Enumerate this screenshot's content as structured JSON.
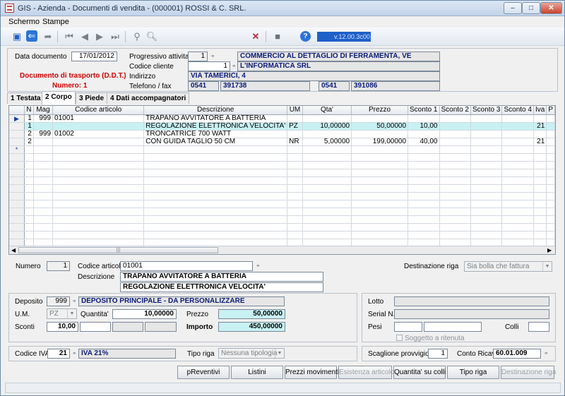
{
  "window": {
    "title": "GIS - Azienda - Documenti di vendita - (000001) ROSSI & C. SRL.",
    "min": "‒",
    "max": "□",
    "close": "✕"
  },
  "menu": [
    "Schermo",
    "Stampe"
  ],
  "toolbar": {
    "version": "v.12.00.3c00"
  },
  "header": {
    "data_documento_label": "Data documento",
    "data_documento": "17/01/2012",
    "progressivo_label": "Progressivo attivita'",
    "progressivo": "1",
    "attivita": "COMMERCIO AL DETTAGLIO DI FERRAMENTA, VE",
    "codice_cliente_label": "Codice cliente",
    "codice_cliente": "1",
    "cliente": "L'INFORMATICA SRL",
    "indirizzo_label": "Indirizzo",
    "indirizzo": "VIA TAMERICI, 4",
    "telefono_label": "Telefono / fax",
    "tel_prefix": "0541",
    "tel": "391738",
    "fax_prefix": "0541",
    "fax": "391086",
    "doc_type": "Documento di trasporto (D.D.T.)",
    "numero": "Numero: 1"
  },
  "tabs": [
    "1 Testata",
    "2 Corpo",
    "3 Piede",
    "4 Dati accompagnatori"
  ],
  "grid": {
    "columns": [
      "N",
      "Mag",
      "Codice articolo",
      "Descrizione",
      "UM",
      "Qta'",
      "Prezzo",
      "Sconto 1",
      "Sconto 2",
      "Sconto 3",
      "Sconto 4",
      "Iva",
      "P"
    ],
    "rows": [
      {
        "marker": "▶",
        "n": "1",
        "mag": "999",
        "codice": "01001",
        "desc": "TRAPANO AVVITATORE A BATTERIA",
        "um": "",
        "qta": "",
        "prezzo": "",
        "s1": "",
        "iva": ""
      },
      {
        "marker": "",
        "n": "1",
        "mag": "",
        "codice": "",
        "desc": "REGOLAZIONE ELETTRONICA VELOCITA'",
        "um": "PZ",
        "qta": "10,00000",
        "prezzo": "50,00000",
        "s1": "10,00",
        "iva": "21"
      },
      {
        "marker": "",
        "n": "2",
        "mag": "999",
        "codice": "01002",
        "desc": "TRONCATRICE 700 WATT",
        "um": "",
        "qta": "",
        "prezzo": "",
        "s1": "",
        "iva": ""
      },
      {
        "marker": "",
        "n": "2",
        "mag": "",
        "codice": "",
        "desc": "CON GUIDA TAGLIO 50 CM",
        "um": "NR",
        "qta": "5,00000",
        "prezzo": "199,00000",
        "s1": "40,00",
        "iva": "21"
      },
      {
        "marker": "*",
        "n": "",
        "mag": "",
        "codice": "",
        "desc": "",
        "um": "",
        "qta": "",
        "prezzo": "",
        "s1": "",
        "iva": ""
      }
    ]
  },
  "detail": {
    "numero_label": "Numero",
    "numero": "1",
    "codice_articolo_label": "Codice articolo",
    "codice_articolo": "01001",
    "descrizione_label": "Descrizione",
    "descrizione1": "TRAPANO AVVITATORE A BATTERIA",
    "descrizione2": "REGOLAZIONE ELETTRONICA VELOCITA'",
    "destinazione_label": "Destinazione riga",
    "destinazione": "Sia bolla che fattura",
    "deposito_label": "Deposito",
    "deposito": "999",
    "deposito_desc": "DEPOSITO PRINCIPALE - DA PERSONALIZZARE",
    "um_label": "U.M.",
    "um": "PZ",
    "quantita_label": "Quantita'",
    "quantita": "10,00000",
    "prezzo_label": "Prezzo",
    "prezzo": "50,00000",
    "sconti_label": "Sconti",
    "sconto1": "10,00",
    "importo_label": "Importo",
    "importo": "450,00000",
    "lotto_label": "Lotto",
    "serial_label": "Serial N.",
    "pesi_label": "Pesi",
    "colli_label": "Colli",
    "soggetto_label": "Soggetto a ritenuta",
    "iva_label": "Codice IVA",
    "iva": "21",
    "iva_desc": "IVA 21%",
    "tipo_riga_label": "Tipo riga",
    "tipo_riga": "Nessuna tipologia",
    "scaglione_label": "Scaglione provvigioni",
    "scaglione": "1",
    "conto_label": "Conto Ricavi",
    "conto": "60.01.009"
  },
  "buttons": [
    "pReventivi",
    "Listini",
    "Prezzi movimenti",
    "Esistenza articolo",
    "Quantita' su colli",
    "Tipo riga",
    "Destinazione riga"
  ],
  "colors": {
    "accent": "#1c3f9c",
    "doc_red": "#d00000",
    "highlight": "#c8f1f3"
  }
}
